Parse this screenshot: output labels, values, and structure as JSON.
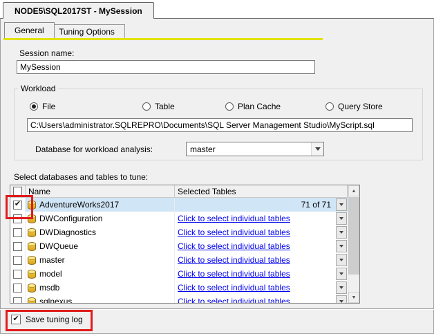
{
  "window": {
    "title": "NODE5\\SQL2017ST - MySession"
  },
  "tabs": {
    "general": "General",
    "tuning_options": "Tuning Options"
  },
  "session": {
    "label": "Session name:",
    "value": "MySession"
  },
  "workload": {
    "group_label": "Workload",
    "options": [
      {
        "label": "File",
        "selected": true
      },
      {
        "label": "Table",
        "selected": false
      },
      {
        "label": "Plan Cache",
        "selected": false
      },
      {
        "label": "Query Store",
        "selected": false
      }
    ],
    "file_path": "C:\\Users\\administrator.SQLREPRO\\Documents\\SQL Server Management Studio\\MyScript.sql",
    "db_label": "Database for workload analysis:",
    "db_value": "master"
  },
  "grid": {
    "label": "Select databases and tables to tune:",
    "columns": {
      "name": "Name",
      "selected_tables": "Selected Tables"
    },
    "rows": [
      {
        "name": "AdventureWorks2017",
        "checked": true,
        "selected": true,
        "link": false,
        "selected_tables": "71 of 71"
      },
      {
        "name": "DWConfiguration",
        "checked": false,
        "selected": false,
        "link": true,
        "selected_tables": "Click to select individual tables"
      },
      {
        "name": "DWDiagnostics",
        "checked": false,
        "selected": false,
        "link": true,
        "selected_tables": "Click to select individual tables"
      },
      {
        "name": "DWQueue",
        "checked": false,
        "selected": false,
        "link": true,
        "selected_tables": "Click to select individual tables"
      },
      {
        "name": "master",
        "checked": false,
        "selected": false,
        "link": true,
        "selected_tables": "Click to select individual tables"
      },
      {
        "name": "model",
        "checked": false,
        "selected": false,
        "link": true,
        "selected_tables": "Click to select individual tables"
      },
      {
        "name": "msdb",
        "checked": false,
        "selected": false,
        "link": true,
        "selected_tables": "Click to select individual tables"
      },
      {
        "name": "sqlnexus",
        "checked": false,
        "selected": false,
        "link": true,
        "selected_tables": "Click to select individual tables"
      }
    ]
  },
  "footer": {
    "save_label": "Save tuning log",
    "checked": true
  },
  "scrollbar": {
    "up_arrow": "▲",
    "down_arrow": "▼"
  },
  "colors": {
    "accent_yellow": "#e3e300",
    "highlight_red": "#e01b1b",
    "link_blue": "#0000ee",
    "selection_blue": "#d0e5f5"
  }
}
